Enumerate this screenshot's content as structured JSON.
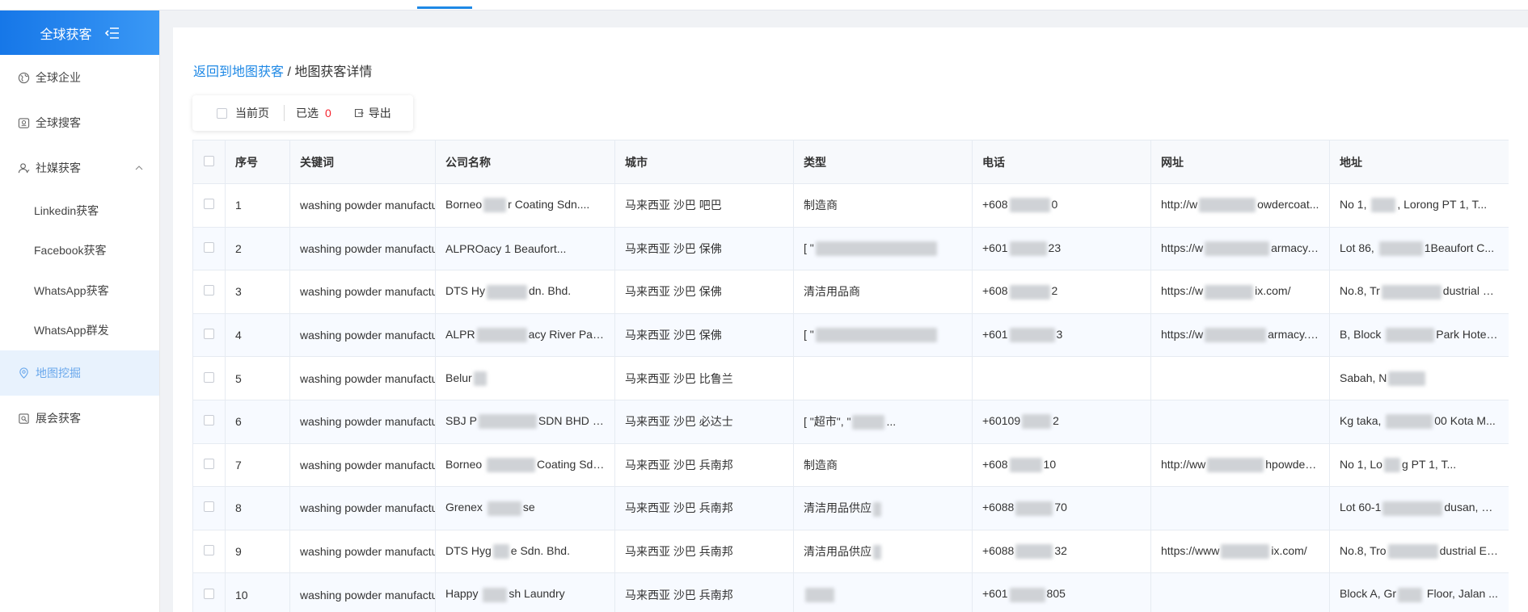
{
  "app": {
    "title": "全球获客"
  },
  "sidebar": {
    "items": [
      {
        "label": "全球企业",
        "icon": "globe-icon",
        "level": 1
      },
      {
        "label": "全球搜客",
        "icon": "search-box-icon",
        "level": 1
      },
      {
        "label": "社媒获客",
        "icon": "users-icon",
        "level": 1,
        "expanded": true
      },
      {
        "label": "Linkedin获客",
        "level": 2
      },
      {
        "label": "Facebook获客",
        "level": 2
      },
      {
        "label": "WhatsApp获客",
        "level": 2
      },
      {
        "label": "WhatsApp群发",
        "level": 2
      },
      {
        "label": "地图挖掘",
        "icon": "map-pin-icon",
        "level": 1,
        "active": true
      },
      {
        "label": "展会获客",
        "icon": "exhibition-icon",
        "level": 1
      }
    ]
  },
  "breadcrumb": {
    "back_link": "返回到地图获客",
    "separator": " / ",
    "current": "地图获客详情"
  },
  "toolbar": {
    "current_page_label": "当前页",
    "selected_label": "已选",
    "selected_count": "0",
    "export_label": "导出"
  },
  "table": {
    "headers": {
      "index": "序号",
      "keyword": "关键词",
      "company": "公司名称",
      "city": "城市",
      "type": "类型",
      "phone": "电话",
      "website": "网址",
      "address": "地址"
    },
    "rows": [
      {
        "index": "1",
        "keyword": "washing powder manufactu",
        "company": [
          "Borneo",
          "",
          "r Coating Sdn...."
        ],
        "city": "马来西亚 沙巴 吧巴",
        "type": [
          "制造商"
        ],
        "phone": [
          "+608",
          "",
          "0"
        ],
        "website": [
          "http://w",
          "",
          "owdercoat..."
        ],
        "address": [
          "No 1, ",
          "",
          ", Lorong PT 1, T..."
        ]
      },
      {
        "index": "2",
        "keyword": "washing powder manufactu",
        "company": [
          "ALPRO",
          "",
          "acy 1 Beaufort..."
        ],
        "city": "马来西亚 沙巴 保佛",
        "type": [
          "[ \"",
          "",
          ""
        ],
        "phone": [
          "+601",
          "",
          "23"
        ],
        "website": [
          "https://w",
          "",
          "armacy.c..."
        ],
        "address": [
          "Lot 86, ",
          "",
          "1Beaufort C..."
        ]
      },
      {
        "index": "3",
        "keyword": "washing powder manufactu",
        "company": [
          "DTS Hy",
          "",
          "dn. Bhd."
        ],
        "city": "马来西亚 沙巴 保佛",
        "type": [
          "清洁用品",
          "",
          "商"
        ],
        "phone": [
          "+608",
          "",
          "2"
        ],
        "website": [
          "https://w",
          "",
          "ix.com/"
        ],
        "address": [
          "No.8, Tr",
          "",
          "dustrial Esta..."
        ]
      },
      {
        "index": "4",
        "keyword": "washing powder manufactu",
        "company": [
          "ALPR",
          "",
          "acy River Par..."
        ],
        "city": "马来西亚 沙巴 保佛",
        "type": [
          "[ \"",
          "",
          ""
        ],
        "phone": [
          "+601",
          "",
          "3"
        ],
        "website": [
          "https://w",
          "",
          "armacy.c..."
        ],
        "address": [
          "B, Block ",
          "",
          "Park Hotel ..."
        ]
      },
      {
        "index": "5",
        "keyword": "washing powder manufactu",
        "company": [
          "Belur",
          "",
          ""
        ],
        "city": "马来西亚 沙巴 比鲁兰",
        "type": [
          "",
          "",
          ""
        ],
        "phone": [
          "",
          "",
          ""
        ],
        "website": [
          "",
          "",
          ""
        ],
        "address": [
          "Sabah, N",
          "",
          ""
        ]
      },
      {
        "index": "6",
        "keyword": "washing powder manufactu",
        "company": [
          "SBJ P",
          "",
          "SDN BHD (S..."
        ],
        "city": "马来西亚 沙巴 必达士",
        "type": [
          "[ \"超市\", \"",
          "",
          "..."
        ],
        "phone": [
          "+60109",
          "",
          "2"
        ],
        "website": [
          "",
          "",
          ""
        ],
        "address": [
          "Kg taka, ",
          "",
          "00 Kota M..."
        ]
      },
      {
        "index": "7",
        "keyword": "washing powder manufactu",
        "company": [
          "Borneo ",
          "",
          "Coating Sdn...."
        ],
        "city": "马来西亚 沙巴 兵南邦",
        "type": [
          "制造商"
        ],
        "phone": [
          "+608",
          "",
          "10"
        ],
        "website": [
          "http://ww",
          "",
          "hpowdercoat..."
        ],
        "address": [
          "No 1, Lo",
          "",
          "g PT 1, T..."
        ]
      },
      {
        "index": "8",
        "keyword": "washing powder manufactu",
        "company": [
          "Grenex ",
          "",
          "se"
        ],
        "city": "马来西亚 沙巴 兵南邦",
        "type": [
          "清洁用品供应",
          "",
          ""
        ],
        "phone": [
          "+6088",
          "",
          "70"
        ],
        "website": [
          "",
          "",
          ""
        ],
        "address": [
          "Lot 60-1",
          "",
          "dusan, W..."
        ]
      },
      {
        "index": "9",
        "keyword": "washing powder manufactu",
        "company": [
          "DTS Hyg",
          "",
          "e Sdn. Bhd."
        ],
        "city": "马来西亚 沙巴 兵南邦",
        "type": [
          "清洁用品供应",
          "",
          ""
        ],
        "phone": [
          "+6088",
          "",
          "32"
        ],
        "website": [
          "https://www",
          "",
          "ix.com/"
        ],
        "address": [
          "No.8, Tro",
          "",
          "dustrial Esta..."
        ]
      },
      {
        "index": "10",
        "keyword": "washing powder manufactu",
        "company": [
          "Happy ",
          "",
          "sh Laundry"
        ],
        "city": "马来西亚 沙巴 兵南邦",
        "type": [
          "",
          "",
          ""
        ],
        "phone": [
          "+601",
          "",
          "805"
        ],
        "website": [
          "",
          "",
          ""
        ],
        "address": [
          "Block A, Gr",
          "",
          " Floor, Jalan ..."
        ]
      }
    ]
  },
  "colors": {
    "primary": "#1e88e5",
    "danger": "#f5222d",
    "sidebar_active_bg": "#e8f2fd"
  }
}
